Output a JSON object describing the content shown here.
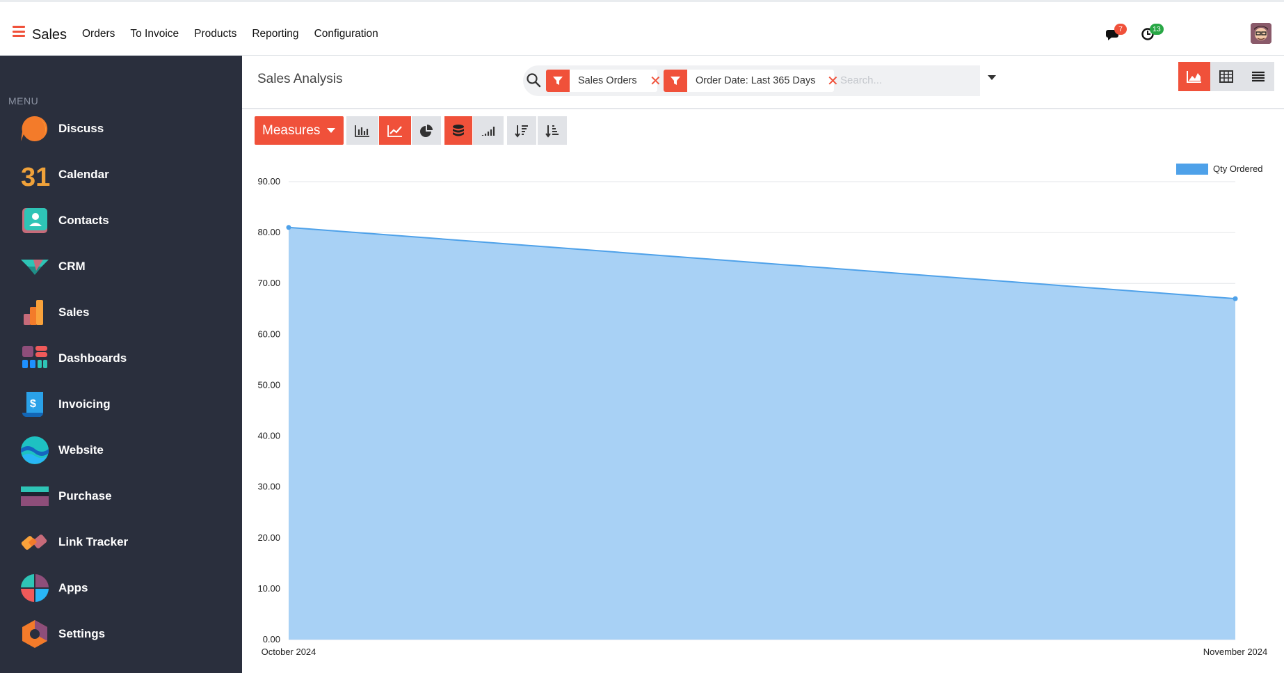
{
  "app": {
    "title": "Sales",
    "menu": [
      "Orders",
      "To Invoice",
      "Products",
      "Reporting",
      "Configuration"
    ],
    "messages_count": "7",
    "activities_count": "13",
    "accent_color": "#f0513a"
  },
  "sidebar": {
    "caption": "MENU",
    "items": [
      {
        "label": "Discuss",
        "icon": "discuss-icon"
      },
      {
        "label": "Calendar",
        "icon": "calendar-icon"
      },
      {
        "label": "Contacts",
        "icon": "contacts-icon"
      },
      {
        "label": "CRM",
        "icon": "crm-icon"
      },
      {
        "label": "Sales",
        "icon": "sales-icon"
      },
      {
        "label": "Dashboards",
        "icon": "dashboards-icon"
      },
      {
        "label": "Invoicing",
        "icon": "invoicing-icon"
      },
      {
        "label": "Website",
        "icon": "website-icon"
      },
      {
        "label": "Purchase",
        "icon": "purchase-icon"
      },
      {
        "label": "Link Tracker",
        "icon": "link-tracker-icon"
      },
      {
        "label": "Apps",
        "icon": "apps-icon"
      },
      {
        "label": "Settings",
        "icon": "settings-icon"
      }
    ],
    "calendar_day": "31",
    "invoice_symbol": "$"
  },
  "control_panel": {
    "title": "Sales Analysis",
    "filters": [
      "Sales Orders",
      "Order Date: Last 365 Days"
    ],
    "search_placeholder": "Search...",
    "active_view": "graph"
  },
  "toolbar": {
    "measures_label": "Measures",
    "active_chart_type": "line",
    "stacked": true
  },
  "chart_data": {
    "type": "area",
    "categories": [
      "October 2024",
      "November 2024"
    ],
    "series": [
      {
        "name": "Qty Ordered",
        "values": [
          81,
          67
        ],
        "color": "#4ea1e9",
        "fill": "#a8d1f5"
      }
    ],
    "y_ticks": [
      "0.00",
      "10.00",
      "20.00",
      "30.00",
      "40.00",
      "50.00",
      "60.00",
      "70.00",
      "80.00",
      "90.00"
    ],
    "ylim": [
      0,
      90
    ],
    "grid": true,
    "legend_position": "top-right"
  }
}
